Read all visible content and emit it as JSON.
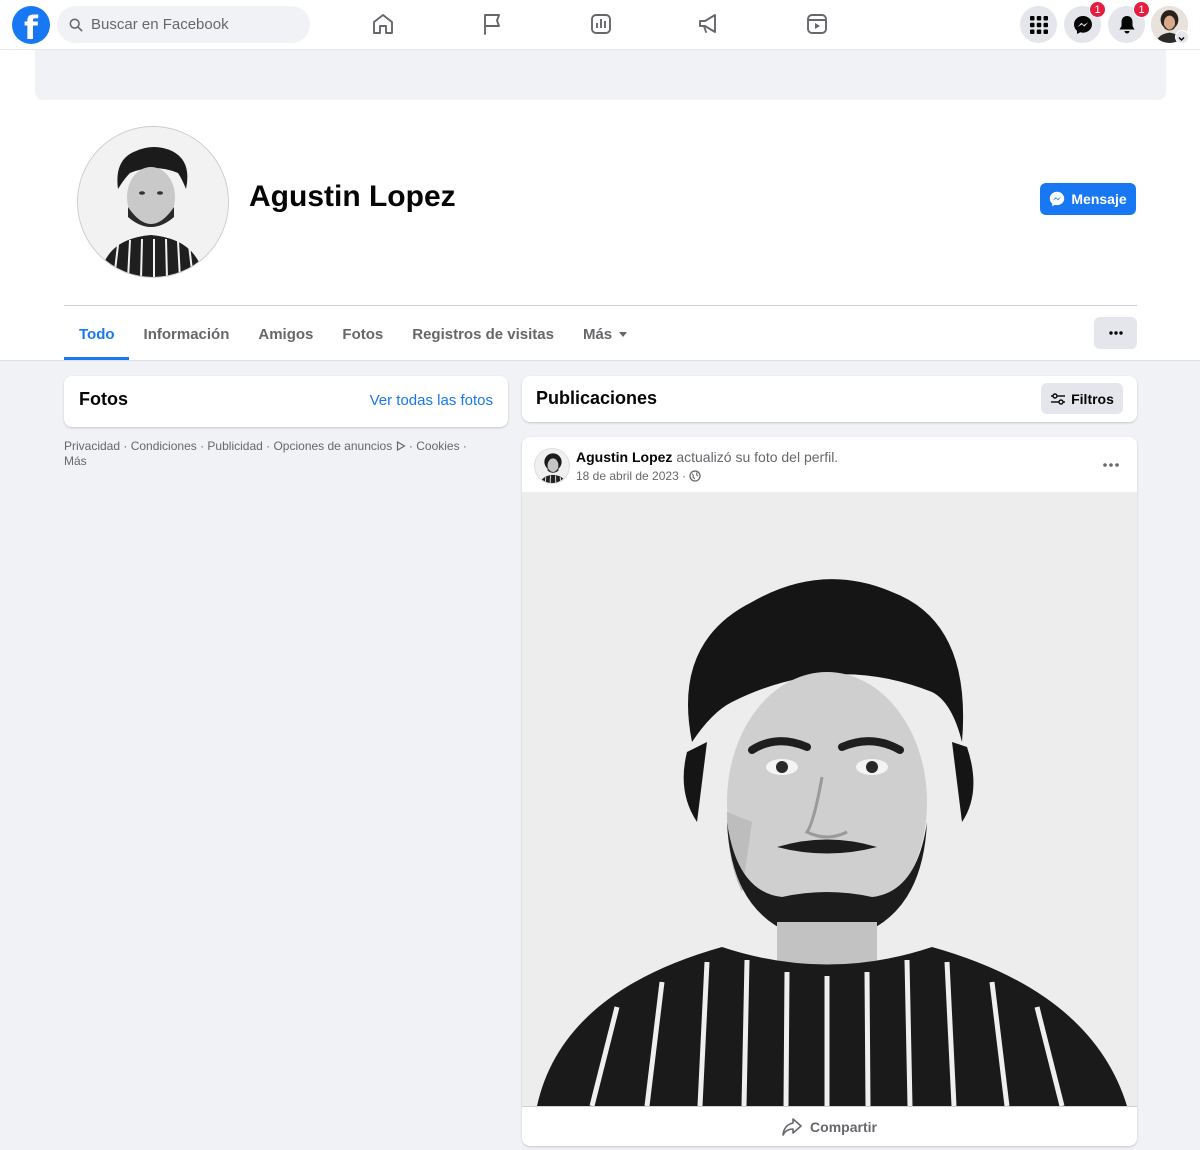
{
  "nav": {
    "search_placeholder": "Buscar en Facebook",
    "messenger_badge": "1",
    "notifications_badge": "1",
    "icons": [
      "home-icon",
      "pages-flag-icon",
      "insights-icon",
      "ads-megaphone-icon",
      "reels-icon"
    ]
  },
  "profile": {
    "name": "Agustin Lopez",
    "message_button": "Mensaje"
  },
  "tabs": [
    "Todo",
    "Información",
    "Amigos",
    "Fotos",
    "Registros de visitas",
    "Más"
  ],
  "photos_card": {
    "title": "Fotos",
    "link": "Ver todas las fotos"
  },
  "footer": {
    "links": [
      "Privacidad",
      "Condiciones",
      "Publicidad",
      "Opciones de anuncios",
      "Cookies",
      "Más"
    ],
    "separator": " · "
  },
  "posts_card": {
    "title": "Publicaciones",
    "filters": "Filtros"
  },
  "post": {
    "author": "Agustin Lopez",
    "action": " actualizó su foto del perfil.",
    "date": "18 de abril de 2023 ·",
    "share": "Compartir"
  },
  "colors": {
    "brand": "#1877f2",
    "badge": "#e41e3f",
    "background": "#f0f2f5"
  }
}
